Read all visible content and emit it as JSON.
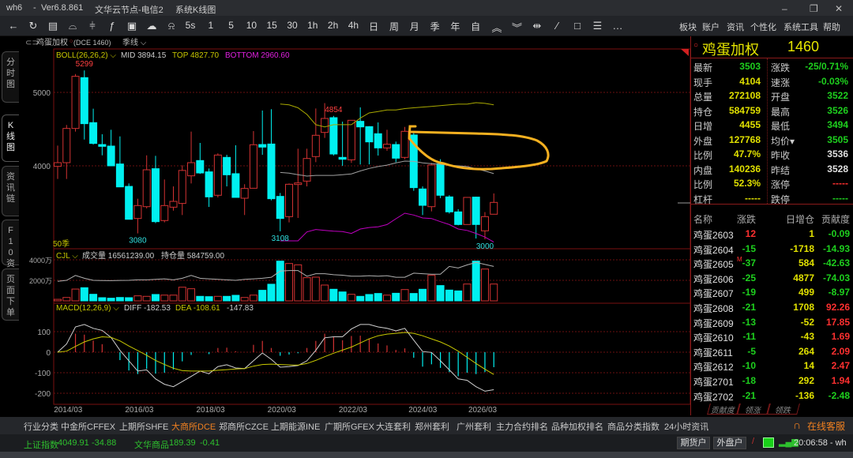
{
  "titlebar": {
    "app": "wh6",
    "sep": "-",
    "version": "Ver6.8.861",
    "node": "文华云节点-电信2",
    "view": "系统K线图",
    "minimize": "–",
    "maximize": "❐",
    "close": "✕"
  },
  "toolbar": {
    "icons": [
      {
        "name": "back-icon",
        "g": "←"
      },
      {
        "name": "refresh-icon",
        "g": "↻"
      },
      {
        "name": "table-icon",
        "g": "▤"
      },
      {
        "name": "line-chart-icon",
        "g": "⌓"
      },
      {
        "name": "candlestick-icon",
        "g": "⫩"
      },
      {
        "name": "formula-icon",
        "g": "ƒ"
      },
      {
        "name": "panel-icon",
        "g": "▣"
      },
      {
        "name": "cloud-icon",
        "g": "☁"
      },
      {
        "name": "bell-icon",
        "g": "⍾"
      }
    ],
    "periods": [
      "5s",
      "1",
      "5",
      "10",
      "15",
      "30",
      "1h",
      "2h",
      "4h",
      "日",
      "周",
      "月",
      "季",
      "年",
      "自"
    ],
    "tools": [
      {
        "name": "zoom-in-icon",
        "g": "︽"
      },
      {
        "name": "zoom-out-icon",
        "g": "︾"
      },
      {
        "name": "expand-icon",
        "g": "⇹"
      },
      {
        "name": "draw-line-icon",
        "g": "∕"
      },
      {
        "name": "rectangle-icon",
        "g": "□"
      },
      {
        "name": "list-icon",
        "g": "☰"
      },
      {
        "name": "more-icon",
        "g": "…"
      }
    ],
    "menu": [
      "板块",
      "账户",
      "资讯",
      "个性化",
      "系统工具",
      "帮助"
    ]
  },
  "sidebar": [
    "分时图",
    "K线图",
    "资讯链",
    "F10资料",
    "页面下单"
  ],
  "chart_header": {
    "name": "鸡蛋加权",
    "mark": "○",
    "code": "(DCE 1460)",
    "period": "季线 ⌵"
  },
  "boll": {
    "label": "BOLL(26,26,2) ⌵",
    "mid": "MID 3894.15",
    "top": "TOP 4827.70",
    "bottom": "BOTTOM 2960.60"
  },
  "vol_header": {
    "label": "CJL ⌵",
    "vol": "成交量 16561239.00",
    "oi": "持仓量 584759.00"
  },
  "macd_header": {
    "label": "MACD(12,26,9) ⌵",
    "diff": "DIFF -182.53",
    "dea": "DEA -108.61",
    "macd": "-147.83"
  },
  "colors": {
    "up": "#d23232",
    "down": "#00f0f0",
    "boll_top": "#a8a800",
    "boll_mid": "#a0a0a0",
    "boll_bottom": "#c000c0",
    "diff": "#d0d0d0",
    "dea": "#c8c800",
    "annotation": "#f5b020"
  },
  "chart_data": {
    "type": "candlestick",
    "period": "quarterly",
    "count_label": "50季",
    "price_ticks": [
      5000,
      4000
    ],
    "vol_ticks": [
      "4000万",
      "2000万"
    ],
    "vol_tick_values": [
      4000,
      2000
    ],
    "macd_ticks": [
      100,
      0,
      -100,
      -200
    ],
    "x_labels": [
      {
        "i": 1,
        "t": "2014/03"
      },
      {
        "i": 9,
        "t": "2016/03"
      },
      {
        "i": 17,
        "t": "2018/03"
      },
      {
        "i": 25,
        "t": "2020/03"
      },
      {
        "i": 33,
        "t": "2022/03"
      },
      {
        "i": 41,
        "t": "2024/03"
      },
      {
        "i": 49,
        "t": "2026/03"
      }
    ],
    "annotations": [
      {
        "i": 3,
        "t": "5299",
        "type": "high"
      },
      {
        "i": 31,
        "t": "4854",
        "type": "high"
      },
      {
        "i": 9,
        "t": "3080",
        "type": "low"
      },
      {
        "i": 25,
        "t": "3108",
        "type": "low"
      },
      {
        "i": 48,
        "t": "3000",
        "type": "low"
      }
    ],
    "ohlc": [
      [
        3993,
        4276,
        3821,
        4043
      ],
      [
        4043,
        4556,
        3821,
        4509
      ],
      [
        4509,
        5250,
        4466,
        5219
      ],
      [
        5201,
        5299,
        4358,
        4574
      ],
      [
        4588,
        4778,
        4290,
        4305
      ],
      [
        4290,
        4430,
        4143,
        4265
      ],
      [
        4269,
        4491,
        4000,
        4000
      ],
      [
        4025,
        4401,
        3713,
        3713
      ],
      [
        3720,
        3760,
        3270,
        3272
      ],
      [
        3283,
        3552,
        3080,
        3459
      ],
      [
        3444,
        4143,
        3420,
        3946
      ],
      [
        3961,
        4136,
        3220,
        3240
      ],
      [
        3255,
        3814,
        3230,
        3459
      ],
      [
        3437,
        3720,
        3390,
        3516
      ],
      [
        3488,
        4007,
        3330,
        3937
      ],
      [
        3864,
        4466,
        3760,
        4043
      ],
      [
        4072,
        4312,
        3890,
        3903
      ],
      [
        3918,
        3964,
        3440,
        3577
      ],
      [
        3599,
        4170,
        3570,
        4147
      ],
      [
        4115,
        4150,
        3720,
        3878
      ],
      [
        3893,
        4280,
        3570,
        3570
      ],
      [
        3559,
        3750,
        3330,
        3692
      ],
      [
        3695,
        4473,
        3695,
        4287
      ],
      [
        4290,
        4753,
        4150,
        4255
      ],
      [
        4297,
        4771,
        3530,
        3552
      ],
      [
        3584,
        3630,
        3108,
        3283
      ],
      [
        3308,
        3760,
        3230,
        3749
      ],
      [
        3760,
        4233,
        3290,
        3767
      ],
      [
        3792,
        4233,
        3720,
        4100
      ],
      [
        4126,
        4781,
        4050,
        4416
      ],
      [
        4455,
        4854,
        4380,
        4645
      ],
      [
        4656,
        4680,
        4140,
        4161
      ],
      [
        4115,
        4602,
        4000,
        4090
      ],
      [
        4082,
        4620,
        4040,
        4620
      ],
      [
        4606,
        4796,
        4018,
        4530
      ],
      [
        4534,
        4540,
        4020,
        4326
      ],
      [
        4437,
        4591,
        4140,
        4244
      ],
      [
        4244,
        4491,
        4205,
        4294
      ],
      [
        4290,
        4330,
        4050,
        4104
      ],
      [
        4115,
        4530,
        4090,
        4470
      ],
      [
        4420,
        4470,
        3660,
        3703
      ],
      [
        3685,
        3720,
        3330,
        3462
      ],
      [
        3444,
        4040,
        3380,
        4011
      ],
      [
        4029,
        4090,
        3560,
        3599
      ],
      [
        3577,
        3600,
        3350,
        3373
      ],
      [
        3373,
        3410,
        3190,
        3201
      ],
      [
        3201,
        3570,
        3200,
        3570
      ],
      [
        3574,
        3580,
        3010,
        3201
      ],
      [
        3115,
        3370,
        3000,
        3308
      ],
      [
        3341,
        3624,
        3480,
        3502
      ]
    ],
    "boll_start": 25,
    "boll_top": [
      4842,
      4830,
      4790,
      4700,
      4560,
      4530,
      4560,
      4560,
      4560,
      4650,
      4720,
      4740,
      4760,
      4760,
      4780,
      4790,
      4800,
      4810,
      4820,
      4830,
      4840,
      4840,
      4860,
      4850,
      4830
    ],
    "boll_mid": [
      3910,
      3900,
      3880,
      3860,
      3870,
      3870,
      3870,
      3880,
      3890,
      3930,
      3964,
      3990,
      4010,
      4040,
      4065,
      4060,
      4040,
      4030,
      4020,
      4010,
      4000,
      3990,
      3960,
      3930,
      3894
    ],
    "boll_bottom": [
      2979,
      2979,
      2979,
      3100,
      3133,
      3120,
      3110,
      3104,
      3080,
      3140,
      3160,
      3170,
      3200,
      3280,
      3355,
      3330,
      3290,
      3283,
      3240,
      3200,
      3140,
      3120,
      3080,
      3030,
      2961
    ],
    "volume": [
      150,
      330,
      1150,
      1280,
      640,
      310,
      260,
      330,
      310,
      490,
      440,
      620,
      560,
      560,
      1330,
      1180,
      440,
      410,
      440,
      440,
      540,
      330,
      560,
      1030,
      1620,
      3870,
      3640,
      3510,
      2260,
      2310,
      1540,
      1130,
      870,
      640,
      440,
      620,
      720,
      560,
      740,
      1100,
      720,
      1130,
      2510,
      1490,
      1050,
      970,
      1640,
      3870,
      3100,
      1640
    ],
    "vol_ma": [
      1900,
      2000,
      2480,
      2200,
      2000,
      1980,
      1970,
      1990,
      2000,
      2050,
      2050,
      2100,
      2150,
      2050,
      2200,
      2480,
      2200,
      2150,
      2100,
      2050,
      2000,
      2100,
      2150,
      2200,
      2300,
      2900,
      2950,
      2950,
      2400,
      2650,
      2650,
      2550,
      2500,
      2400,
      2400,
      2450,
      2400,
      2450,
      2300,
      2300,
      2700,
      2650,
      2600,
      2600,
      3350,
      3200,
      3500,
      3750,
      3550,
      3350
    ],
    "macd_hist": [
      0,
      0,
      180,
      171,
      113,
      78,
      0,
      -77,
      -178,
      -213,
      -162,
      -209,
      -200,
      -168,
      -89,
      -27,
      0,
      -19,
      41,
      44,
      9,
      0,
      72,
      110,
      41,
      -35,
      -23,
      -10,
      41,
      110,
      180,
      151,
      116,
      158,
      161,
      129,
      85,
      66,
      22,
      37,
      -54,
      -141,
      -118,
      -153,
      -194,
      -234,
      -200,
      -213,
      -194,
      -146
    ],
    "diff": [
      0,
      40,
      123,
      135,
      116,
      106,
      72,
      9,
      -42,
      -92,
      -86,
      -130,
      -156,
      -168,
      -143,
      -118,
      -92,
      -105,
      -70,
      -61,
      -77,
      -80,
      -42,
      -4,
      -35,
      -73,
      -70,
      -65,
      -42,
      9,
      70,
      75,
      75,
      113,
      135,
      135,
      123,
      116,
      104,
      116,
      59,
      3,
      -1,
      -42,
      -86,
      -130,
      -137,
      -168,
      -190,
      -182.53
    ],
    "dea": [
      0,
      5,
      28,
      50,
      65,
      75,
      72,
      55,
      30,
      8,
      -15,
      -40,
      -60,
      -78,
      -90,
      -92,
      -92,
      -92,
      -88,
      -85,
      -82,
      -80,
      -68,
      -60,
      -58,
      -60,
      -62,
      -63,
      -55,
      -40,
      -22,
      -5,
      10,
      25,
      45,
      65,
      80,
      88,
      92,
      96,
      92,
      80,
      65,
      50,
      30,
      5,
      -25,
      -55,
      -83,
      -108.61
    ]
  },
  "quote": {
    "marker": "○",
    "title": "鸡蛋加权",
    "code": "1460",
    "rows": [
      {
        "l1": "最新",
        "v1": "3503",
        "c1": "g",
        "l2": "涨跌",
        "v2": "-25/0.71%",
        "c2": "g"
      },
      {
        "l1": "现手",
        "v1": "4104",
        "c1": "y",
        "l2": "速涨",
        "v2": "-0.03%",
        "c2": "g"
      },
      {
        "l1": "总量",
        "v1": "272108",
        "c1": "y",
        "l2": "开盘",
        "v2": "3522",
        "c2": "g"
      },
      {
        "l1": "持仓",
        "v1": "584759",
        "c1": "y",
        "l2": "最高",
        "v2": "3526",
        "c2": "g"
      },
      {
        "l1": "日增",
        "v1": "4455",
        "c1": "y",
        "l2": "最低",
        "v2": "3494",
        "c2": "g"
      },
      {
        "l1": "外盘",
        "v1": "127768",
        "c1": "y",
        "l2": "均价▾",
        "v2": "3505",
        "c2": "g"
      },
      {
        "l1": "比例",
        "v1": "47.7%",
        "c1": "y",
        "l2": "昨收",
        "v2": "3536",
        "c2": "w"
      },
      {
        "l1": "内盘",
        "v1": "140236",
        "c1": "y",
        "l2": "昨结",
        "v2": "3528",
        "c2": "w"
      },
      {
        "l1": "比例",
        "v1": "52.3%",
        "c1": "y",
        "l2": "涨停",
        "v2": "-----",
        "c2": "r"
      },
      {
        "l1": "杠杆",
        "v1": "-----",
        "c1": "y",
        "l2": "跌停",
        "v2": "-----",
        "c2": "g"
      }
    ]
  },
  "contracts": {
    "headers": [
      "名称",
      "涨跌",
      "日增仓",
      "贡献度"
    ],
    "rows": [
      {
        "name": "鸡蛋2603",
        "chg": "12",
        "inc": "1",
        "con": "-0.09",
        "m": ""
      },
      {
        "name": "鸡蛋2604",
        "chg": "-15",
        "inc": "-1718",
        "con": "-14.93",
        "m": ""
      },
      {
        "name": "鸡蛋2605",
        "chg": "-37",
        "inc": "584",
        "con": "-42.63",
        "m": "M"
      },
      {
        "name": "鸡蛋2606",
        "chg": "-25",
        "inc": "4877",
        "con": "-74.03",
        "m": ""
      },
      {
        "name": "鸡蛋2607",
        "chg": "-19",
        "inc": "499",
        "con": "-8.97",
        "m": ""
      },
      {
        "name": "鸡蛋2608",
        "chg": "-21",
        "inc": "1708",
        "con": "92.26",
        "m": ""
      },
      {
        "name": "鸡蛋2609",
        "chg": "-13",
        "inc": "-52",
        "con": "17.85",
        "m": ""
      },
      {
        "name": "鸡蛋2610",
        "chg": "-11",
        "inc": "-43",
        "con": "1.69",
        "m": ""
      },
      {
        "name": "鸡蛋2611",
        "chg": "-5",
        "inc": "264",
        "con": "2.09",
        "m": ""
      },
      {
        "name": "鸡蛋2612",
        "chg": "-10",
        "inc": "14",
        "con": "2.47",
        "m": ""
      },
      {
        "name": "鸡蛋2701",
        "chg": "-18",
        "inc": "292",
        "con": "1.94",
        "m": ""
      },
      {
        "name": "鸡蛋2702",
        "chg": "-21",
        "inc": "-136",
        "con": "-2.48",
        "m": ""
      }
    ],
    "tabs": [
      "贡献度",
      "领涨",
      "领跌"
    ]
  },
  "nav": {
    "items": [
      "行业分类",
      "中金所CFFEX",
      "上期所SHFE",
      "大商所DCE",
      "郑商所CZCE",
      "上期能源INE",
      "广期所GFEX",
      "大连套利",
      "郑州套利",
      "广州套利",
      "主力合约排名",
      "品种加权排名",
      "商品分类指数",
      "24小时资讯"
    ],
    "active": 3,
    "service": "在线客服"
  },
  "status": {
    "idx1_name": "上证指数",
    "idx1_val": "4049.91",
    "idx1_chg": "-34.88",
    "idx2_name": "文华商品",
    "idx2_val": "189.39",
    "idx2_chg": "-0.41",
    "btn1": "期货户",
    "btn2": "外盘户",
    "time": "20:06:58 - wh"
  }
}
